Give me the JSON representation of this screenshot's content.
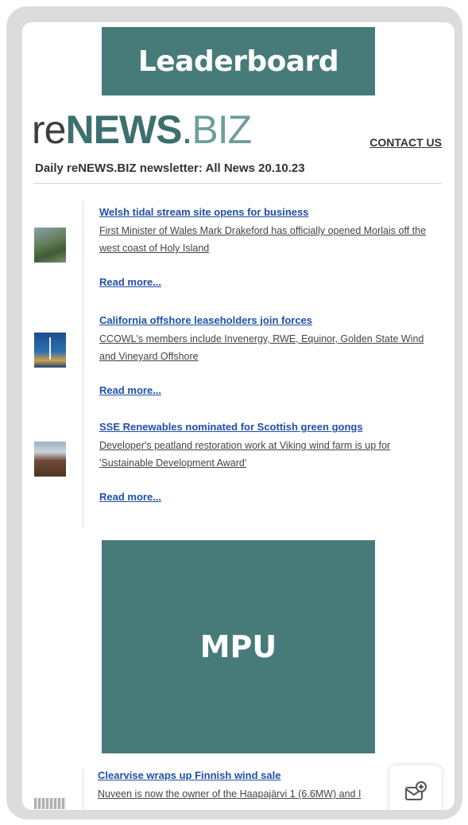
{
  "ads": {
    "leaderboard": "Leaderboard",
    "mpu": "MPU",
    "color": "#477b7a"
  },
  "brand": {
    "logo_re": "re",
    "logo_news": "NEWS",
    "logo_dot": ".",
    "logo_biz": "BIZ"
  },
  "header": {
    "contact_label": "CONTACT US",
    "newsletter_title": "Daily reNEWS.BIZ newsletter: All News 20.10.23"
  },
  "articles": [
    {
      "title": "Welsh tidal stream site opens for business",
      "summary": "First Minister of Wales Mark Drakeford has officially opened Morlais off the west coast of Holy Island",
      "read_more": "Read more..."
    },
    {
      "title": "California offshore leaseholders join forces",
      "summary": "CCOWL's members include Invenergy, RWE, Equinor, Golden State Wind and Vineyard Offshore",
      "read_more": "Read more..."
    },
    {
      "title": "SSE Renewables nominated for Scottish green gongs",
      "summary": "Developer's peatland restoration work at Viking wind farm is up for 'Sustainable Development Award'",
      "read_more": "Read more..."
    },
    {
      "title": "Clearvise wraps up Finnish wind sale",
      "summary": "Nuveen is now the owner of the Haapajärvi 1 (6.6MW) and I"
    }
  ],
  "fab": {
    "icon": "mail-add-icon"
  }
}
